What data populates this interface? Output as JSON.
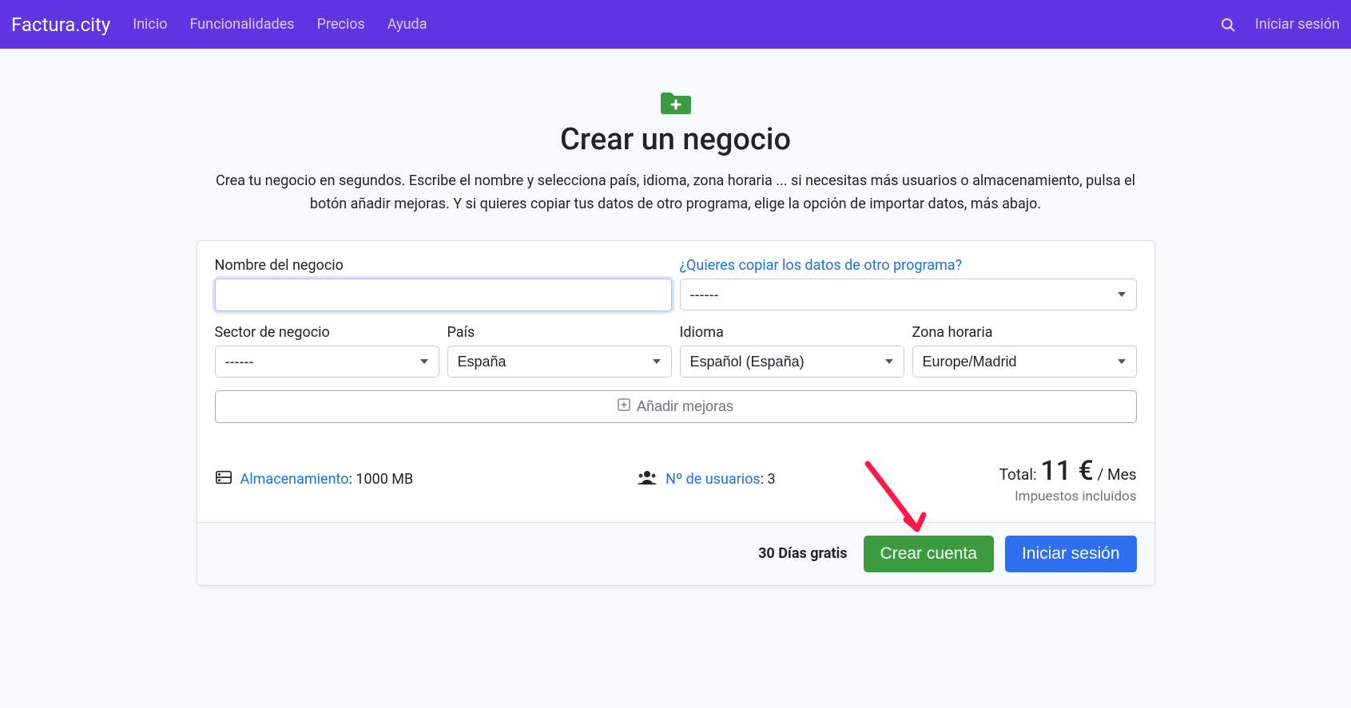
{
  "nav": {
    "brand": "Factura.city",
    "links": [
      "Inicio",
      "Funcionalidades",
      "Precios",
      "Ayuda"
    ],
    "login": "Iniciar sesión"
  },
  "header": {
    "title": "Crear un negocio",
    "subtitle": "Crea tu negocio en segundos. Escribe el nombre y selecciona país, idioma, zona horaria ... si necesitas más usuarios o almacenamiento, pulsa el botón añadir mejoras. Y si quieres copiar tus datos de otro programa, elige la opción de importar datos, más abajo."
  },
  "form": {
    "business_name_label": "Nombre del negocio",
    "business_name_value": "",
    "copy_data_label": "¿Quieres copiar los datos de otro programa?",
    "copy_data_value": "------",
    "sector_label": "Sector de negocio",
    "sector_value": "------",
    "country_label": "País",
    "country_value": "España",
    "language_label": "Idioma",
    "language_value": "Español (España)",
    "timezone_label": "Zona horaria",
    "timezone_value": "Europe/Madrid",
    "add_improvements_label": "Añadir mejoras"
  },
  "info": {
    "storage_label": "Almacenamiento",
    "storage_value": ": 1000 MB",
    "users_label": "Nº de usuarios",
    "users_value": ": 3",
    "total_label": "Total: ",
    "total_amount": "11 €",
    "total_period": " / Mes",
    "tax_note": "Impuestos incluidos"
  },
  "footer": {
    "trial": "30 Días gratis",
    "create_account": "Crear cuenta",
    "login": "Iniciar sesión"
  },
  "colors": {
    "primary": "#5e35e1",
    "success": "#3b9b3e",
    "blue": "#2e6ff2",
    "link": "#1a73e8"
  }
}
